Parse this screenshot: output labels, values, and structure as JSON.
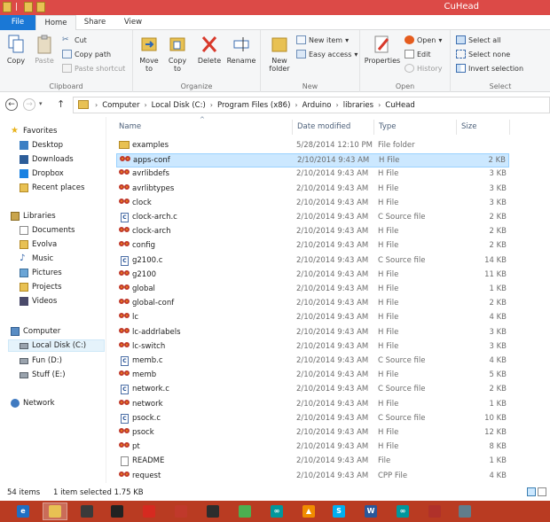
{
  "window": {
    "title": "CuHead"
  },
  "tabs": {
    "file": "File",
    "home": "Home",
    "share": "Share",
    "view": "View"
  },
  "ribbon": {
    "clipboard": {
      "label": "Clipboard",
      "copy": "Copy",
      "paste": "Paste",
      "cut": "Cut",
      "copy_path": "Copy path",
      "paste_shortcut": "Paste shortcut"
    },
    "organize": {
      "label": "Organize",
      "move_to": "Move",
      "move_to2": "to",
      "copy_to": "Copy",
      "copy_to2": "to",
      "delete": "Delete",
      "rename": "Rename"
    },
    "new": {
      "label": "New",
      "new_folder": "New",
      "new_folder2": "folder",
      "new_item": "New item",
      "easy_access": "Easy access"
    },
    "open": {
      "label": "Open",
      "properties": "Properties",
      "open": "Open",
      "edit": "Edit",
      "history": "History"
    },
    "select": {
      "label": "Select",
      "select_all": "Select all",
      "select_none": "Select none",
      "invert": "Invert selection"
    }
  },
  "address": {
    "crumbs": [
      "Computer",
      "Local Disk (C:)",
      "Program Files (x86)",
      "Arduino",
      "libraries",
      "CuHead"
    ]
  },
  "nav": {
    "favorites": "Favorites",
    "desktop": "Desktop",
    "downloads": "Downloads",
    "dropbox": "Dropbox",
    "recent": "Recent places",
    "libraries": "Libraries",
    "documents": "Documents",
    "evolva": "Evolva",
    "music": "Music",
    "pictures": "Pictures",
    "projects": "Projects",
    "videos": "Videos",
    "computer": "Computer",
    "local_disk": "Local Disk (C:)",
    "fun": "Fun (D:)",
    "stuff": "Stuff (E:)",
    "network": "Network"
  },
  "columns": {
    "name": "Name",
    "date": "Date modified",
    "type": "Type",
    "size": "Size"
  },
  "files": [
    {
      "name": "examples",
      "date": "5/28/2014 12:10 PM",
      "type": "File folder",
      "size": "",
      "icon": "folder"
    },
    {
      "name": "apps-conf",
      "date": "2/10/2014 9:43 AM",
      "type": "H File",
      "size": "2 KB",
      "icon": "h",
      "selected": true
    },
    {
      "name": "avrlibdefs",
      "date": "2/10/2014 9:43 AM",
      "type": "H File",
      "size": "3 KB",
      "icon": "h"
    },
    {
      "name": "avrlibtypes",
      "date": "2/10/2014 9:43 AM",
      "type": "H File",
      "size": "3 KB",
      "icon": "h"
    },
    {
      "name": "clock",
      "date": "2/10/2014 9:43 AM",
      "type": "H File",
      "size": "3 KB",
      "icon": "h"
    },
    {
      "name": "clock-arch.c",
      "date": "2/10/2014 9:43 AM",
      "type": "C Source file",
      "size": "2 KB",
      "icon": "c"
    },
    {
      "name": "clock-arch",
      "date": "2/10/2014 9:43 AM",
      "type": "H File",
      "size": "2 KB",
      "icon": "h"
    },
    {
      "name": "config",
      "date": "2/10/2014 9:43 AM",
      "type": "H File",
      "size": "2 KB",
      "icon": "h"
    },
    {
      "name": "g2100.c",
      "date": "2/10/2014 9:43 AM",
      "type": "C Source file",
      "size": "14 KB",
      "icon": "c"
    },
    {
      "name": "g2100",
      "date": "2/10/2014 9:43 AM",
      "type": "H File",
      "size": "11 KB",
      "icon": "h"
    },
    {
      "name": "global",
      "date": "2/10/2014 9:43 AM",
      "type": "H File",
      "size": "1 KB",
      "icon": "h"
    },
    {
      "name": "global-conf",
      "date": "2/10/2014 9:43 AM",
      "type": "H File",
      "size": "2 KB",
      "icon": "h"
    },
    {
      "name": "lc",
      "date": "2/10/2014 9:43 AM",
      "type": "H File",
      "size": "4 KB",
      "icon": "h"
    },
    {
      "name": "lc-addrlabels",
      "date": "2/10/2014 9:43 AM",
      "type": "H File",
      "size": "3 KB",
      "icon": "h"
    },
    {
      "name": "lc-switch",
      "date": "2/10/2014 9:43 AM",
      "type": "H File",
      "size": "3 KB",
      "icon": "h"
    },
    {
      "name": "memb.c",
      "date": "2/10/2014 9:43 AM",
      "type": "C Source file",
      "size": "4 KB",
      "icon": "c"
    },
    {
      "name": "memb",
      "date": "2/10/2014 9:43 AM",
      "type": "H File",
      "size": "5 KB",
      "icon": "h"
    },
    {
      "name": "network.c",
      "date": "2/10/2014 9:43 AM",
      "type": "C Source file",
      "size": "2 KB",
      "icon": "c"
    },
    {
      "name": "network",
      "date": "2/10/2014 9:43 AM",
      "type": "H File",
      "size": "1 KB",
      "icon": "h"
    },
    {
      "name": "psock.c",
      "date": "2/10/2014 9:43 AM",
      "type": "C Source file",
      "size": "10 KB",
      "icon": "c"
    },
    {
      "name": "psock",
      "date": "2/10/2014 9:43 AM",
      "type": "H File",
      "size": "12 KB",
      "icon": "h"
    },
    {
      "name": "pt",
      "date": "2/10/2014 9:43 AM",
      "type": "H File",
      "size": "8 KB",
      "icon": "h"
    },
    {
      "name": "README",
      "date": "2/10/2014 9:43 AM",
      "type": "File",
      "size": "1 KB",
      "icon": "doc"
    },
    {
      "name": "request",
      "date": "2/10/2014 9:43 AM",
      "type": "CPP File",
      "size": "4 KB",
      "icon": "h"
    }
  ],
  "status": {
    "count": "54 items",
    "selected": "1 item selected  1.75 KB"
  },
  "taskbar": [
    "ie-icon",
    "file-explorer-icon",
    "app-icon-1",
    "app-icon-2",
    "app-icon-3",
    "app-icon-4",
    "app-icon-5",
    "chrome-icon",
    "arduino-icon",
    "vlc-icon",
    "skype-icon",
    "word-icon",
    "arduino-icon-2",
    "app-icon-6",
    "app-icon-7"
  ],
  "colors": {
    "accent": "#dc4a47",
    "file_tab": "#1a78d6",
    "taskbar": "#b93b22",
    "selection": "#cce8ff"
  }
}
